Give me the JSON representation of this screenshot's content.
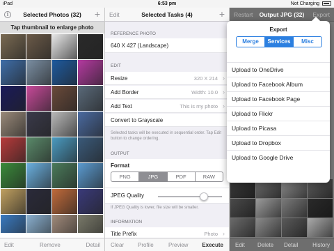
{
  "status": {
    "left": "iPad",
    "time": "6:53 pm",
    "right": "Not Charging"
  },
  "left": {
    "info_label": "i",
    "title": "Selected Photos (32)",
    "plus": "+",
    "hint": "Tap thumbnail to enlarge photo",
    "toolbar": [
      "Edit",
      "Remove",
      "Detail"
    ],
    "thumb_colors": [
      "#7a6a52",
      "#6b5a48",
      "#e8e8e8",
      "#2a2a2a",
      "#3f6ea8",
      "#7b8fa3",
      "#1e5a9e",
      "#b43aa0",
      "#1a1a5a",
      "#c84a9a",
      "#6a4a3a",
      "#5a6a7a",
      "#9a8a7a",
      "#3a3a4a",
      "#b8b8b8",
      "#4a6aa0",
      "#b83a3a",
      "#5a8a6a",
      "#4a9ac0",
      "#3a5a7a",
      "#3a8a3a",
      "#6ab0e0",
      "#4a7a5a",
      "#5a9ad0",
      "#c0a060",
      "#2a2a3a",
      "#c06a3a",
      "#3a3a7a",
      "#3a7ac0",
      "#8ab0d0",
      "#a08a7a",
      "#7a7a6a"
    ]
  },
  "middle": {
    "nav_left": "Edit",
    "title": "Selected Tasks (4)",
    "plus": "+",
    "section_reference": "REFERENCE PHOTO",
    "reference_value": "640 X 427 (Landscape)",
    "section_edit": "EDIT",
    "rows": [
      {
        "label": "Resize",
        "value": "320 X 214"
      },
      {
        "label": "Add Border",
        "value": "Width: 10.0"
      },
      {
        "label": "Add Text",
        "value": "This is my photo"
      },
      {
        "label": "Convert to Grayscale",
        "value": ""
      }
    ],
    "note_order": "Selected tasks will be executed in sequential order. Tap Edit button to change ordering.",
    "section_output": "OUTPUT",
    "format_label": "Format",
    "formats": [
      "PNG",
      "JPG",
      "PDF",
      "RAW"
    ],
    "format_selected": "JPG",
    "quality_label": "JPEG Quality",
    "quality_level": 0.72,
    "note_quality": "If JPEG Quality is lower, file size will be smaller.",
    "section_information": "INFORMATION",
    "title_prefix_label": "Title Prefix",
    "title_prefix_value": "Photo",
    "toolbar": [
      "Clear",
      "Profile",
      "Preview",
      "Execute"
    ]
  },
  "right": {
    "nav_left": "Restart",
    "title": "Output JPG (32)",
    "nav_right": "Export",
    "toolbar": [
      "Edit",
      "Delete",
      "Detail",
      "History"
    ],
    "thumb_colors": [
      "#3a3a3a",
      "#6a6a6a",
      "#8a8a8a",
      "#5a5a5a",
      "#4a4a4a",
      "#9a9a9a",
      "#7a7a7a",
      "#2a2a2a",
      "#6a6a6a",
      "#8a8a8a",
      "#5a5a5a",
      "#aaaaaa"
    ]
  },
  "popover": {
    "title": "Export",
    "tabs": [
      "Merge",
      "Services",
      "Misc"
    ],
    "tab_selected": "Services",
    "services": [
      "Upload to OneDrive",
      "Upload to Facebook Album",
      "Upload to Facebook Page",
      "Upload to Flickr",
      "Upload to Picasa",
      "Upload to Dropbox",
      "Upload to Google Drive"
    ]
  }
}
